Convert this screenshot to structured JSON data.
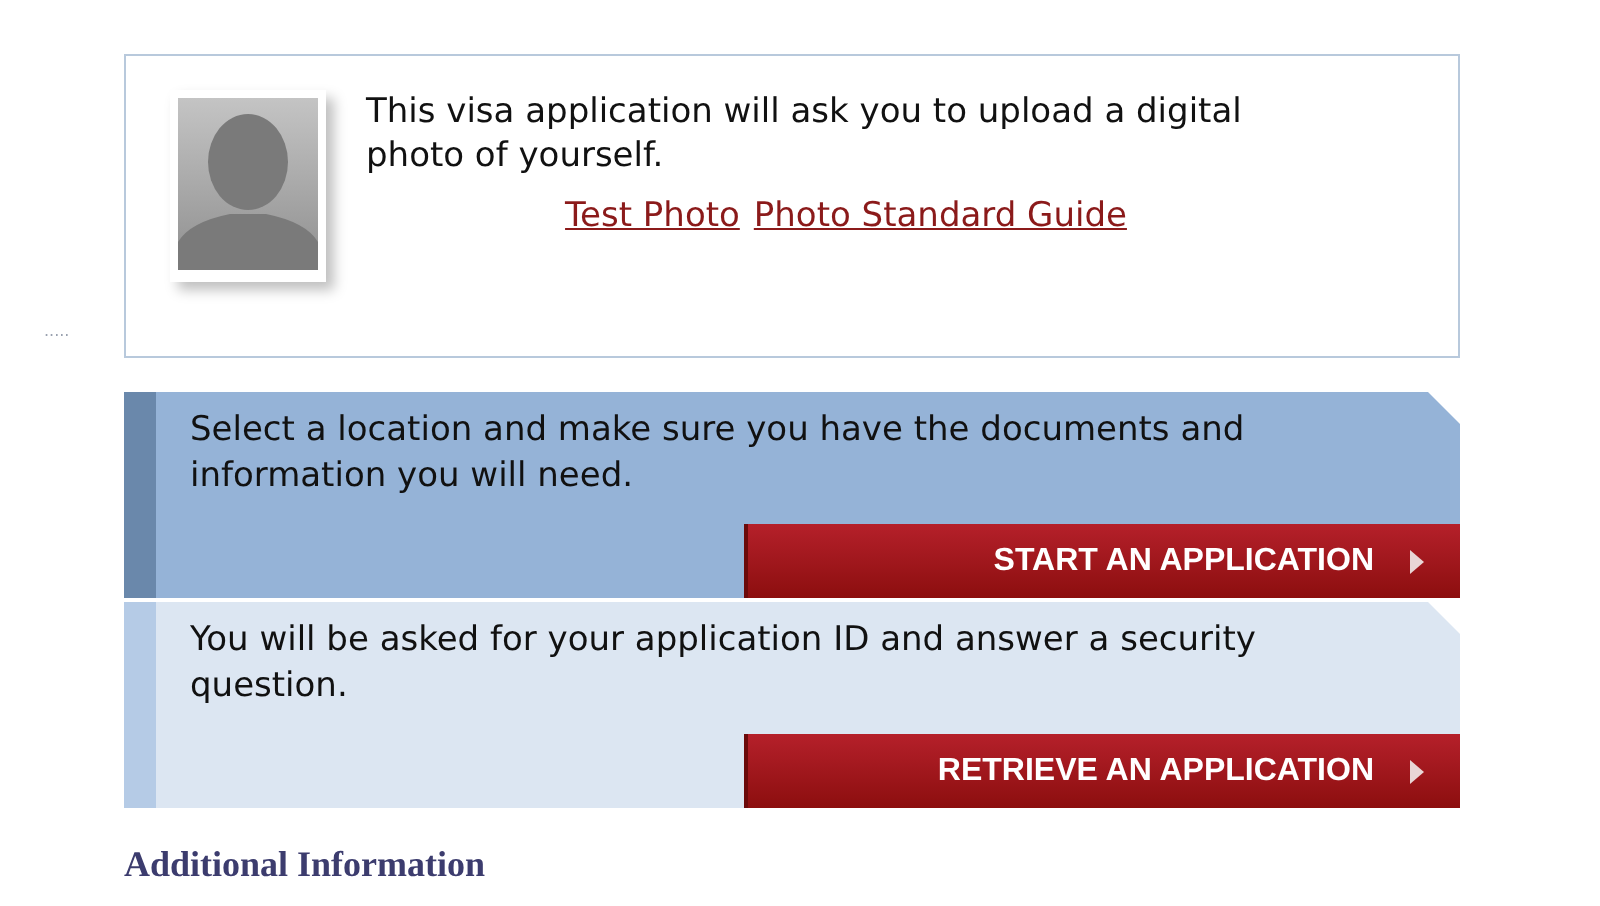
{
  "photo_notice": {
    "text": "This visa application will ask you to upload a digital photo of yourself.",
    "links": [
      "Test Photo",
      "Photo Standard Guide"
    ]
  },
  "side_mark": ".....",
  "panels": [
    {
      "kind": "primary",
      "text": "Select a location and make sure you have the documents and information you will need.",
      "button": "START AN APPLICATION"
    },
    {
      "kind": "secondary",
      "text": "You will be asked for your application ID and answer a security question.",
      "button": "RETRIEVE AN APPLICATION"
    }
  ],
  "heading": "Additional Information"
}
